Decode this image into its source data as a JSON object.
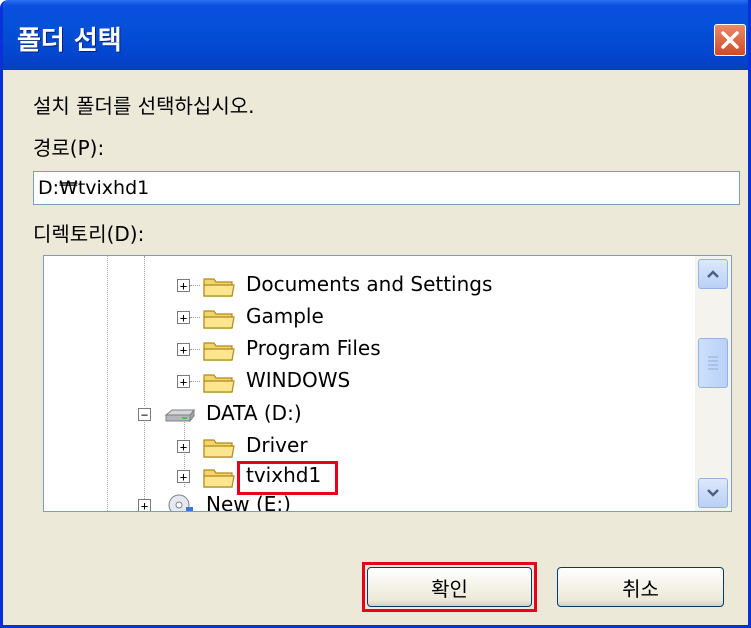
{
  "window": {
    "title": "폴더 선택",
    "instruction": "설치 폴더를 선택하십시오.",
    "path_label": "경로(P):",
    "path_value": "D:₩tvixhd1",
    "directory_label": "디렉토리(D):"
  },
  "tree": {
    "items": [
      {
        "label": "Documents and Settings",
        "icon": "folder-icon",
        "expander": "+"
      },
      {
        "label": "Gample",
        "icon": "folder-icon",
        "expander": "+"
      },
      {
        "label": "Program Files",
        "icon": "folder-icon",
        "expander": "+"
      },
      {
        "label": "WINDOWS",
        "icon": "folder-icon",
        "expander": "+"
      },
      {
        "label": "DATA (D:)",
        "icon": "drive-icon",
        "expander": "−"
      },
      {
        "label": "Driver",
        "icon": "folder-icon",
        "expander": "+"
      },
      {
        "label": "tvixhd1",
        "icon": "folder-icon",
        "expander": "+",
        "selected": true
      },
      {
        "label": "New (E:)",
        "icon": "cd-drive-icon",
        "expander": "+"
      }
    ]
  },
  "buttons": {
    "ok_label": "확인",
    "cancel_label": "취소"
  },
  "colors": {
    "title_bar": "#0450d8",
    "dialog_bg": "#ece9d8",
    "highlight": "#e8001c",
    "folder": "#f5d569"
  }
}
